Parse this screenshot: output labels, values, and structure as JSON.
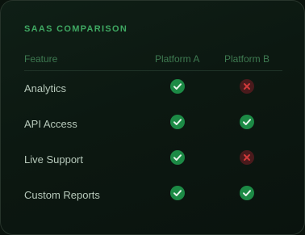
{
  "card": {
    "title": "SAAS COMPARISON"
  },
  "table": {
    "headers": {
      "feature": "Feature",
      "platform_a": "Platform A",
      "platform_b": "Platform B"
    },
    "rows": [
      {
        "feature": "Analytics",
        "platform_a": "check-icon",
        "platform_b": "cross-icon"
      },
      {
        "feature": "API Access",
        "platform_a": "check-icon",
        "platform_b": "check-icon"
      },
      {
        "feature": "Live Support",
        "platform_a": "check-icon",
        "platform_b": "cross-icon"
      },
      {
        "feature": "Custom Reports",
        "platform_a": "check-icon",
        "platform_b": "check-icon"
      }
    ]
  },
  "colors": {
    "accent": "#3fa862",
    "check_bg": "#1c8a45",
    "cross_bg": "#4a1a1c",
    "cross_mark": "#d03a3a"
  }
}
